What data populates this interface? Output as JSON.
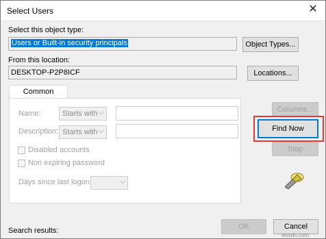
{
  "window": {
    "title": "Select Users",
    "close_glyph": "✕"
  },
  "object_type": {
    "label": "Select this object type:",
    "value": "Users or Built-in security principals",
    "button": "Object Types..."
  },
  "location": {
    "label": "From this location:",
    "value": "DESKTOP-P2P8ICF",
    "button": "Locations..."
  },
  "tabs": [
    {
      "label": "Common Queries",
      "active": true
    }
  ],
  "queries": {
    "name_label": "Name:",
    "name_mode": "Starts with",
    "name_value": "",
    "description_label": "Description:",
    "description_mode": "Starts with",
    "description_value": "",
    "disabled_accounts_label": "Disabled accounts",
    "disabled_accounts_checked": false,
    "non_expiring_label": "Non expiring password",
    "non_expiring_checked": false,
    "days_label": "Days since last logon:",
    "days_value": ""
  },
  "side_buttons": {
    "columns": "Columns...",
    "find_now": "Find Now",
    "stop": "Stop"
  },
  "icons": {
    "search": "search-flashlight-icon"
  },
  "results_label": "Search results:",
  "footer": {
    "ok": "OK",
    "cancel": "Cancel"
  },
  "watermark": "wsxdn.com",
  "colors": {
    "accent": "#0078d7",
    "highlight": "#e53935"
  }
}
